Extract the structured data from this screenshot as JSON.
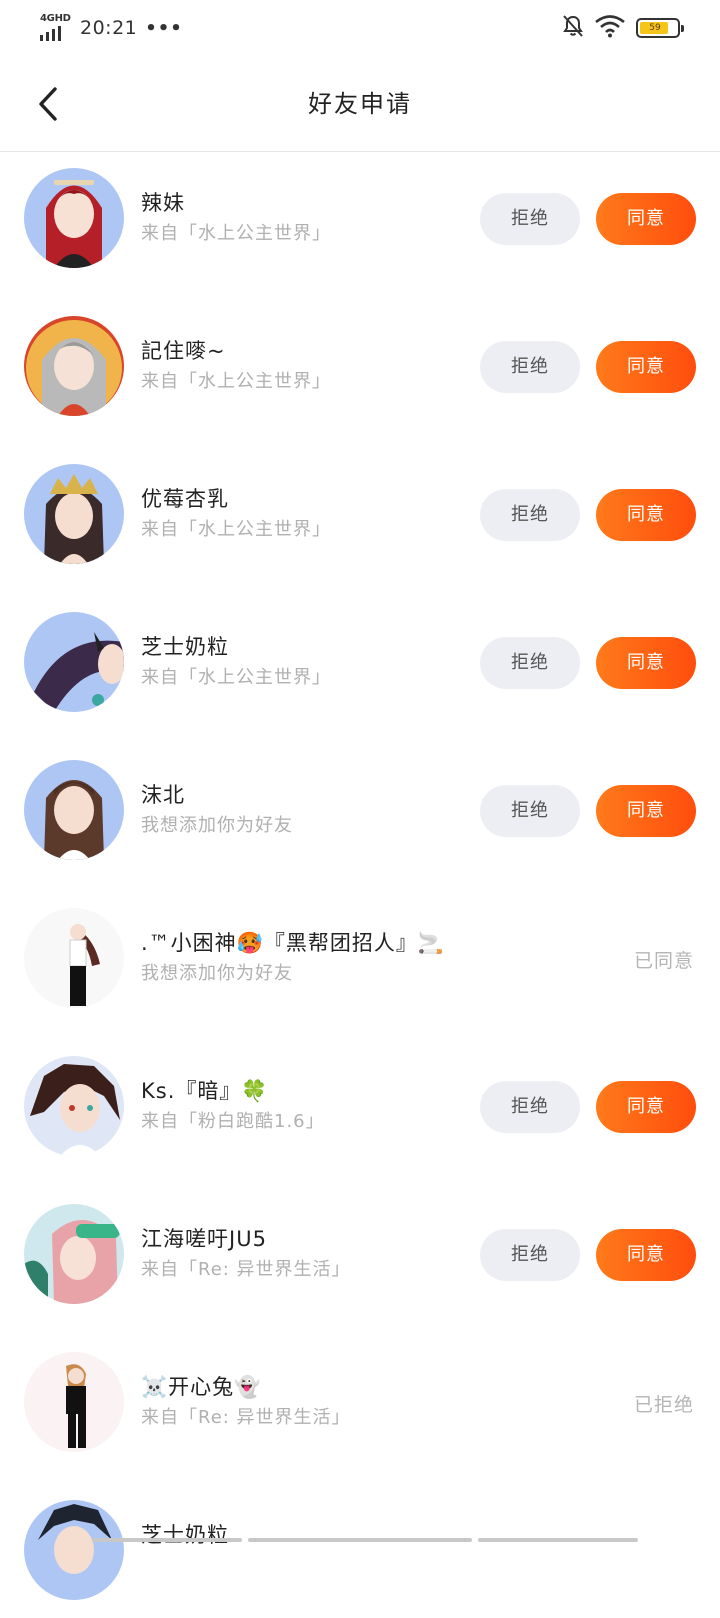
{
  "status_bar": {
    "network": "4GHD",
    "time": "20:21",
    "dots": "•••",
    "battery": "59"
  },
  "header": {
    "title": "好友申请"
  },
  "buttons": {
    "reject": "拒绝",
    "accept": "同意"
  },
  "requests": [
    {
      "name": "辣妹",
      "source": "来自「水上公主世界」",
      "state": "pending"
    },
    {
      "name": "記住嘜~",
      "source": "来自「水上公主世界」",
      "state": "pending"
    },
    {
      "name": "优莓杏乳",
      "source": "来自「水上公主世界」",
      "state": "pending"
    },
    {
      "name": "芝士奶粒",
      "source": "来自「水上公主世界」",
      "state": "pending"
    },
    {
      "name": "沫北",
      "source": "我想添加你为好友",
      "state": "pending"
    },
    {
      "name": ".™小困神🥵『黑帮团招人』🚬",
      "source": "我想添加你为好友",
      "state": "accepted",
      "status_label": "已同意"
    },
    {
      "name": "Ks.『暗』🍀",
      "source": "来自「粉白跑酷1.6」",
      "state": "pending"
    },
    {
      "name": "江海嗟吁JU5",
      "source": "来自「Re: 异世界生活」",
      "state": "pending"
    },
    {
      "name": "☠️开心兔👻",
      "source": "来自「Re: 异世界生活」",
      "state": "rejected",
      "status_label": "已拒绝"
    },
    {
      "name": "芝士奶粒",
      "source": "",
      "state": "pending"
    }
  ],
  "colors": {
    "accent_start": "#ff7a1a",
    "accent_end": "#ff4d0d",
    "reject_bg": "#eceef3",
    "muted_text": "#b0b0b0"
  }
}
